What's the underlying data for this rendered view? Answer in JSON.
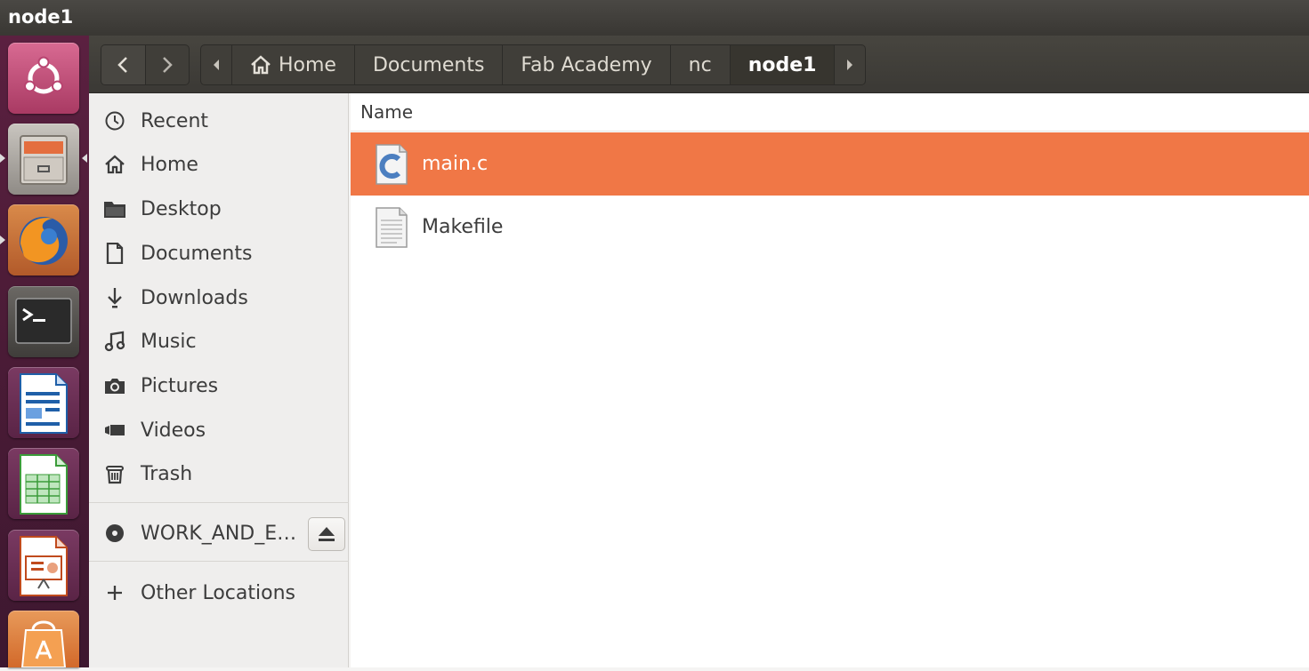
{
  "window": {
    "title": "node1"
  },
  "launcher": {
    "items": [
      {
        "name": "ubuntu-dash",
        "color": "#c2507a"
      },
      {
        "name": "files",
        "color": "#a9a6a2"
      },
      {
        "name": "firefox",
        "color": "#e8841e"
      },
      {
        "name": "terminal",
        "color": "#2e2e2e"
      },
      {
        "name": "libreoffice-writer",
        "color": "#1f5fa8"
      },
      {
        "name": "libreoffice-calc",
        "color": "#3b9c3a"
      },
      {
        "name": "libreoffice-impress",
        "color": "#c04a1d"
      },
      {
        "name": "software-center",
        "color": "#e07a32"
      }
    ]
  },
  "toolbar": {
    "back": "‹",
    "forward": "›",
    "breadcrumb": [
      "Home",
      "Documents",
      "Fab Academy",
      "nc",
      "node1"
    ]
  },
  "sidebar": {
    "places": [
      {
        "label": "Recent",
        "icon": "clock-icon"
      },
      {
        "label": "Home",
        "icon": "home-icon"
      },
      {
        "label": "Desktop",
        "icon": "folder-icon"
      },
      {
        "label": "Documents",
        "icon": "document-icon"
      },
      {
        "label": "Downloads",
        "icon": "download-icon"
      },
      {
        "label": "Music",
        "icon": "music-icon"
      },
      {
        "label": "Pictures",
        "icon": "camera-icon"
      },
      {
        "label": "Videos",
        "icon": "video-icon"
      },
      {
        "label": "Trash",
        "icon": "trash-icon"
      }
    ],
    "device": {
      "label": "WORK_AND_E…",
      "icon": "disc-icon"
    },
    "other": {
      "label": "Other Locations",
      "icon": "plus-icon"
    }
  },
  "files": {
    "column_header": "Name",
    "items": [
      {
        "name": "main.c",
        "icon": "c-source-icon",
        "selected": true
      },
      {
        "name": "Makefile",
        "icon": "text-file-icon",
        "selected": false
      }
    ]
  },
  "colors": {
    "selection": "#f07746",
    "launcher": "#4a1b36",
    "toolbar": "#3f3d39"
  }
}
